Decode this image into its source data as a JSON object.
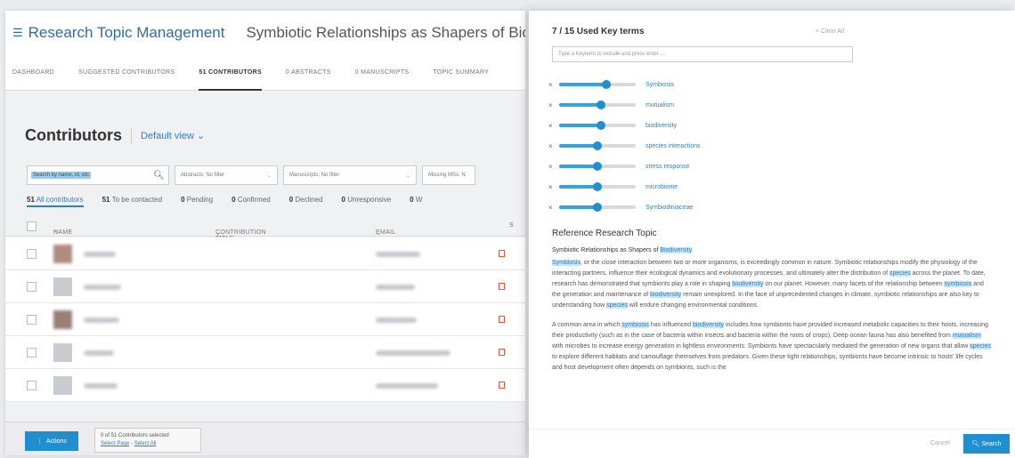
{
  "app": {
    "name": "Research Topic Management",
    "topic_title": "Symbiotic Relationships as Shapers of Biodiversi"
  },
  "tabs": [
    {
      "label": "DASHBOARD"
    },
    {
      "label": "SUGGESTED CONTRIBUTORS"
    },
    {
      "label": "51 CONTRIBUTORS"
    },
    {
      "label": "0 ABSTRACTS"
    },
    {
      "label": "0 MANUSCRIPTS"
    },
    {
      "label": "TOPIC SUMMARY"
    }
  ],
  "contributors": {
    "title": "Contributors",
    "view": "Default view"
  },
  "filters": {
    "search_placeholder": "Search by name, id, etc",
    "abstracts": "Abstracts: No filter",
    "manuscripts": "Manuscripts: No filter",
    "missing": "Missing MSs: N"
  },
  "counts": [
    {
      "n": "51",
      "label": "All contributors"
    },
    {
      "n": "51",
      "label": "To be contacted"
    },
    {
      "n": "0",
      "label": "Pending"
    },
    {
      "n": "0",
      "label": "Confirmed"
    },
    {
      "n": "0",
      "label": "Declined"
    },
    {
      "n": "0",
      "label": "Unresponsive"
    },
    {
      "n": "0",
      "label": "W"
    }
  ],
  "columns": {
    "name": "NAME",
    "contribution_title": "CONTRIBUTION TITLE",
    "email": "EMAIL",
    "s": "S"
  },
  "footer": {
    "actions": "Actions",
    "selected": "0 of 51 Contributors selected",
    "select_page": "Select Page",
    "select_all": "Select All"
  },
  "keyterms": {
    "title": "7 / 15 Used Key terms",
    "clear_all": "Clear All",
    "input_placeholder": "Type a Keyterm to include and press enter ...",
    "terms": [
      {
        "label": "Symbiosis",
        "level": 0.62
      },
      {
        "label": "mutualism",
        "level": 0.55
      },
      {
        "label": "biodiversity",
        "level": 0.55
      },
      {
        "label": "species interactions",
        "level": 0.5
      },
      {
        "label": "stress response",
        "level": 0.5
      },
      {
        "label": "microbiome",
        "level": 0.5
      },
      {
        "label": "Symbiodiniaceae",
        "level": 0.5
      }
    ]
  },
  "reference": {
    "title": "Reference Research Topic",
    "subtitle_plain": "Symbiotic Relationships as Shapers of ",
    "subtitle_hl": "Biodiversity",
    "p1": [
      {
        "t": "Symbiosis",
        "hl": true
      },
      {
        "t": ", or the close interaction between two or more organisms, is exceedingly common in nature. Symbiotic relationships modify the physiology of the interacting partners, influence their ecological dynamics and evolutionary processes, and ultimately alter the distribution of ",
        "hl": false
      },
      {
        "t": "species",
        "hl": true
      },
      {
        "t": " across the planet. To date, research has demonstrated that symbionts play a role in shaping ",
        "hl": false
      },
      {
        "t": "biodiversity",
        "hl": true
      },
      {
        "t": " on our planet. However, many facets of the relationship between ",
        "hl": false
      },
      {
        "t": "symbiosis",
        "hl": true
      },
      {
        "t": " and the generation and maintenance of ",
        "hl": false
      },
      {
        "t": "biodiversity",
        "hl": true
      },
      {
        "t": " remain unexplored. In the face of unprecedented changes in climate, symbiotic relationships are also key to understanding how ",
        "hl": false
      },
      {
        "t": "species",
        "hl": true
      },
      {
        "t": " will endure changing environmental conditions.",
        "hl": false
      }
    ],
    "p2": [
      {
        "t": "A common area in which ",
        "hl": false
      },
      {
        "t": "symbiosis",
        "hl": true
      },
      {
        "t": " has influenced ",
        "hl": false
      },
      {
        "t": "biodiversity",
        "hl": true
      },
      {
        "t": " includes how symbionts have provided increased metabolic capacities to their hosts, increasing their productivity (such as in the case of bacteria within insects and bacteria within the roots of crops). Deep ocean fauna has also benefited from ",
        "hl": false
      },
      {
        "t": "mutualism",
        "hl": true
      },
      {
        "t": " with microbes to increase energy generation in lightless environments. Symbionts have spectacularly mediated the generation of new organs that allow ",
        "hl": false
      },
      {
        "t": "species",
        "hl": true
      },
      {
        "t": " to explore different habitats and camouflage themselves from predators. Given these tight relationships, symbionts have become intrinsic to hosts' life cycles and host development often depends on symbionts, such is the",
        "hl": false
      }
    ]
  },
  "panel_footer": {
    "cancel": "Cancel",
    "search": "Search"
  }
}
